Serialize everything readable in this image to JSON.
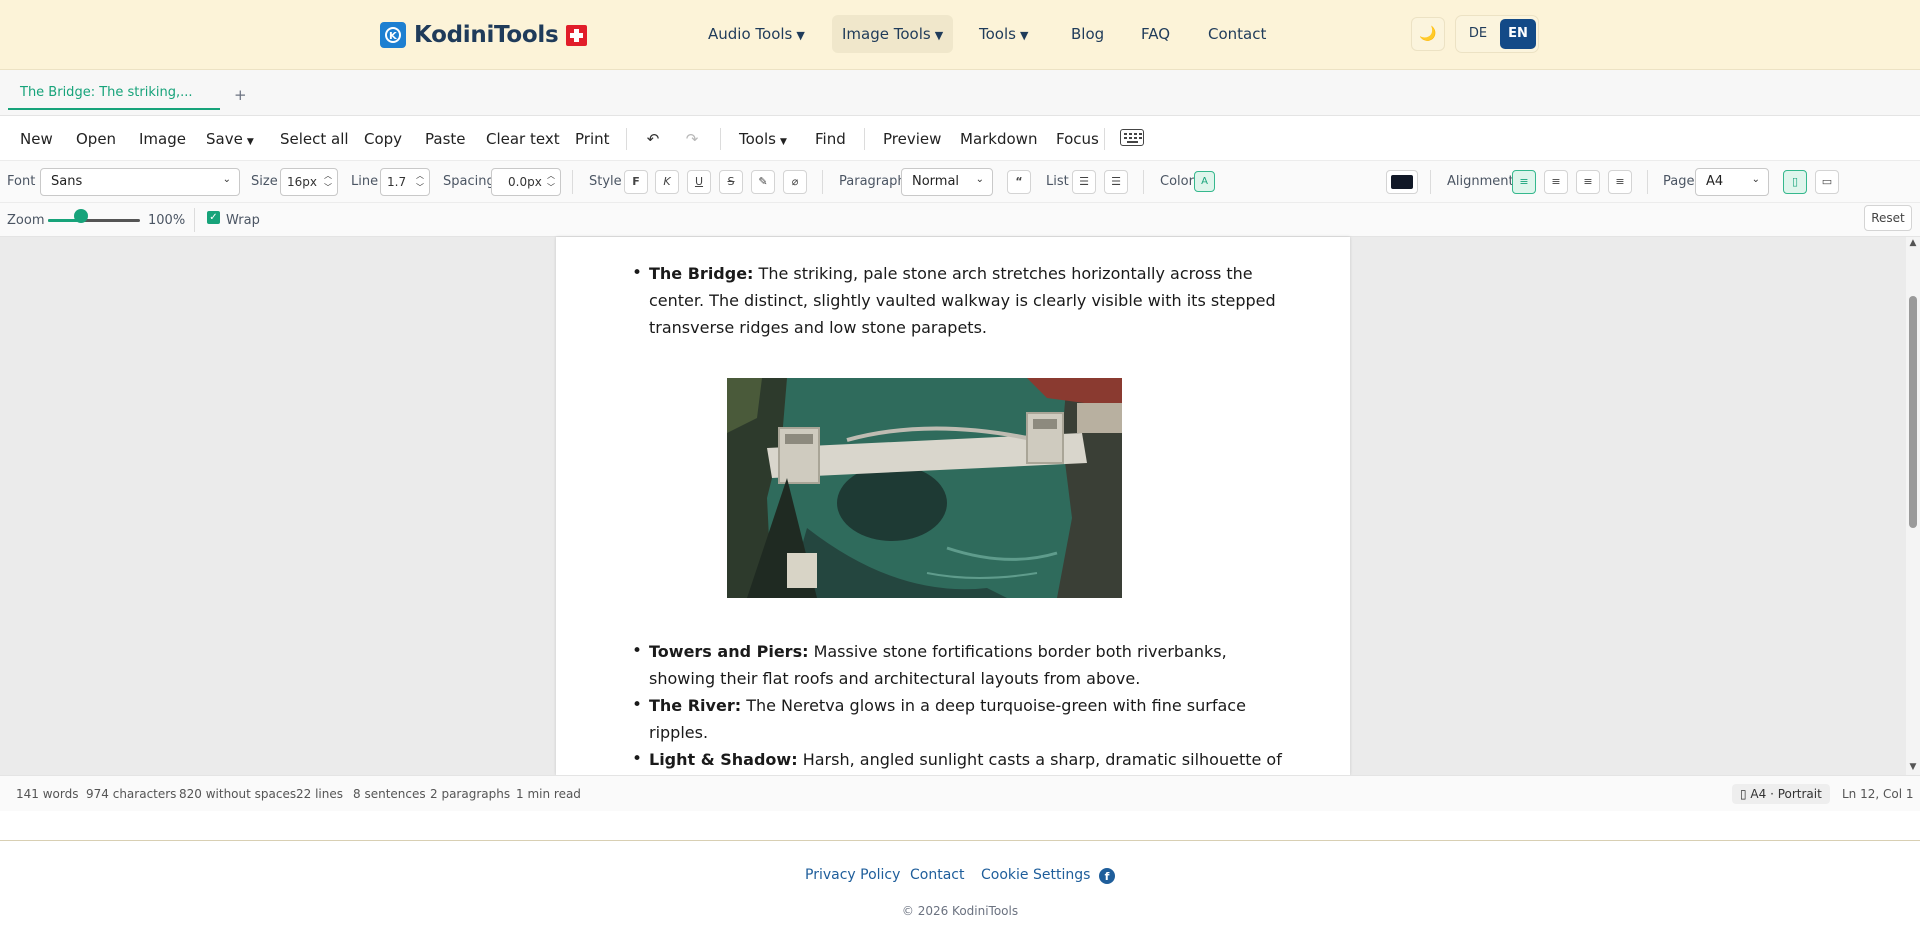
{
  "header": {
    "logo_text": "KodiniTools",
    "nav": [
      {
        "label": "Audio Tools",
        "caret": "▼"
      },
      {
        "label": "Image Tools",
        "caret": "▼"
      },
      {
        "label": "Tools",
        "caret": "▼"
      },
      {
        "label": "Blog"
      },
      {
        "label": "FAQ"
      },
      {
        "label": "Contact"
      }
    ],
    "theme_icon": "moon-icon",
    "lang": {
      "de": "DE",
      "en": "EN"
    }
  },
  "tabs": {
    "active": "The Bridge: The striking,...",
    "add": "+"
  },
  "toolbar": {
    "new": "New",
    "open": "Open",
    "image": "Image",
    "save": "Save",
    "select_all": "Select all",
    "copy": "Copy",
    "paste": "Paste",
    "clear_text": "Clear text",
    "print": "Print",
    "tools": "Tools",
    "find": "Find",
    "preview": "Preview",
    "markdown": "Markdown",
    "focus": "Focus"
  },
  "format": {
    "font_label": "Font",
    "font_value": "Sans",
    "size_label": "Size",
    "size_value": "16px",
    "line_label": "Line",
    "line_value": "1.7",
    "spacing_label": "Spacing",
    "spacing_value": "0.0px",
    "style_label": "Style",
    "style_buttons": [
      "F",
      "K",
      "U",
      "S"
    ],
    "paragraph_label": "Paragraph",
    "paragraph_value": "Normal",
    "quote_glyph": "“",
    "list_label": "List",
    "color_label": "Color",
    "color_auto": "A",
    "colors": [
      "#111827",
      "#6b7280",
      "#c0262d",
      "#cf4a12",
      "#16873f",
      "#1f5fd1",
      "#8a2bd8"
    ],
    "custom_color": "#111827",
    "alignment_label": "Alignment",
    "page_label": "Page",
    "page_value": "A4"
  },
  "view": {
    "zoom_label": "Zoom",
    "zoom_value": "100%",
    "zoom_fraction": 0.36,
    "wrap_label": "Wrap",
    "wrap_checked": true,
    "reset": "Reset"
  },
  "document": {
    "item1_bold": "The Bridge:",
    "item1_text": " The striking, pale stone arch stretches horizontally across the center. The distinct, slightly vaulted walkway is clearly visible with its stepped transverse ridges and low stone parapets.",
    "items": [
      {
        "bold": "Towers and Piers:",
        "text": " Massive stone fortifications border both riverbanks, showing their flat roofs and architectural layouts from above."
      },
      {
        "bold": "The River:",
        "text": " The Neretva glows in a deep turquoise-green with fine surface ripples."
      },
      {
        "bold": "Light & Shadow:",
        "text": " Harsh, angled sunlight casts a sharp, dramatic silhouette of the bridge arch and towers directly onto the water below."
      }
    ]
  },
  "status": {
    "words": "141 words",
    "characters": "974 characters",
    "without_spaces": "820 without spaces",
    "lines": "22 lines",
    "sentences": "8 sentences",
    "paragraphs": "2 paragraphs",
    "read_time": "1 min read",
    "page_format": "A4 · Portrait",
    "cursor": "Ln 12, Col 1"
  },
  "footer": {
    "privacy": "Privacy Policy",
    "contact": "Contact",
    "cookies": "Cookie Settings",
    "copyright": "© 2026 KodiniTools"
  }
}
